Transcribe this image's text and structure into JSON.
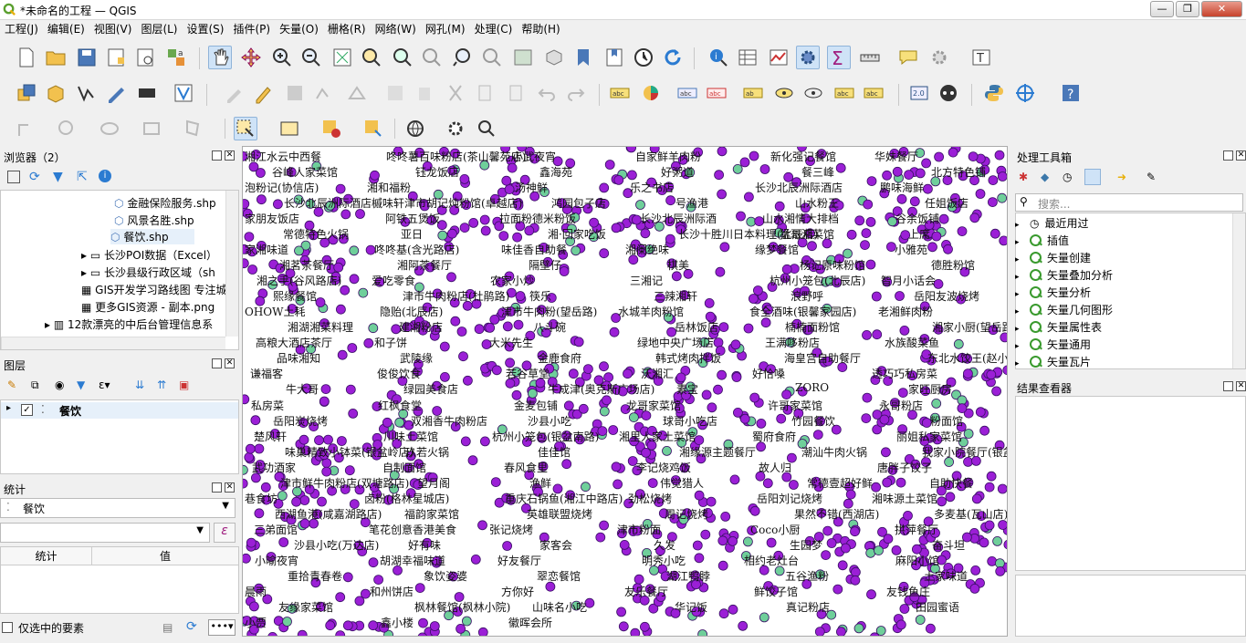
{
  "window": {
    "title": "*未命名的工程 — QGIS",
    "minimize": "—",
    "restore": "❐",
    "close": "✕"
  },
  "menu": [
    "工程(J)",
    "编辑(E)",
    "视图(V)",
    "图层(L)",
    "设置(S)",
    "插件(P)",
    "矢量(O)",
    "栅格(R)",
    "网络(W)",
    "网孔(M)",
    "处理(C)",
    "帮助(H)"
  ],
  "browser": {
    "title": "浏览器（2）",
    "items": [
      "金融保险服务.shp",
      "风景名胜.shp",
      "餐饮.shp",
      "长沙POI数据（Excel）",
      "长沙县级行政区域（sh",
      "GIS开发学习路线图 专注城",
      "更多GIS资源 - 副本.png",
      "12款漂亮的中后台管理信息系"
    ]
  },
  "layers": {
    "title": "图层",
    "items": [
      {
        "name": "餐饮",
        "checked": true
      }
    ]
  },
  "stats": {
    "title": "统计",
    "layer": "餐饮",
    "expr_placeholder": "",
    "col_stat": "统计",
    "col_value": "值",
    "selected_only": "仅选中的要素"
  },
  "toolbox": {
    "title": "处理工具箱",
    "search_placeholder": "搜索...",
    "items": [
      "最近用过",
      "插值",
      "矢量创建",
      "矢量叠加分析",
      "矢量分析",
      "矢量几何图形",
      "矢量属性表",
      "矢量通用",
      "矢量瓦片"
    ]
  },
  "results": {
    "title": "结果查看器"
  },
  "colors": {
    "point_fill": "#9b1fd6",
    "point_stroke": "#3a1066",
    "point_alt": "#6fcf9a",
    "accent": "#3a9a2e"
  },
  "map_labels": [
    "湘江水云中西餐",
    "咚咚薯百味粉店(茶山馨苑店)",
    "小武夜宵",
    "自家鲜羊肉粉",
    "新化强记餐馆",
    "华妹餐厅",
    "谷峰人家菜馆",
    "钰龙饭店",
    "鑫海苑",
    "好粥道",
    "餐三峰",
    "北方特色铺",
    "泡粉记(协信店)",
    "湘和福粉",
    "汤神鲜",
    "乐之书店",
    "长沙北辰洲际酒店",
    "鹏味海鲜",
    "长沙北辰洲际酒店槭味轩",
    "津市胡记炖粉馆(卓越店)",
    "鸿园包子店",
    "号渔港",
    "山水粉王",
    "任姐饭店",
    "家朋友饭店",
    "阿铁五煲饭",
    "拉面粉德米粉饭",
    "长沙北辰洲际酒",
    "山水湘情大排档",
    "谷余饭铺",
    "常德特色火锅",
    "亚日",
    "湘·回家吃饭",
    "长沙十胜川日本料理(北辰店)",
    "猛哥湘菜馆",
    "上席",
    "家湘味道",
    "咚咚基(含光路店)",
    "味佳香自助餐",
    "湘阑绝味",
    "缘梦餐馆",
    "小雅苑",
    "湘茗茶餐厅",
    "湘阿茶餐厅",
    "隔壁仔",
    "棋美",
    "杨记原味粉馆",
    "德胜粉馆",
    "湘之手(谷风路店)",
    "爱吃零食",
    "农家小炒",
    "三湘记",
    "杭州小笼包(北辰店)",
    "智月小话会",
    "熙缘餐馆",
    "津市牛肉粉店(杜鹃路)",
    "筷乐",
    "三辣湘轩",
    "浪野呼",
    "岳阳友波烧烤",
    "OHOW土耗",
    "隐贻(北辰店)",
    "津市牛肉粉(望岳路)",
    "水城羊肉粉馆",
    "食全酒味(银馨家园店)",
    "老湘鲜肉粉",
    "湘湖湘菜料理",
    "建湘粉店",
    "八斗碗",
    "岳林饭店",
    "楠楠面粉馆",
    "湘家小厨(望岳路)",
    "高粮大酒店茶厅",
    "和子饼",
    "大米先生",
    "绿地中央广场店",
    "王满哆粉店",
    "水族酸菜鱼",
    "品味湘知",
    "武陵缘",
    "金鹿食府",
    "韩式烤肉拌饭",
    "海皇宫自助餐厅",
    "东北水饺王(赵小姐河西第三分店)",
    "谦福客",
    "俊俊饮食",
    "若谷草堂",
    "沃湘汇",
    "好恰嗓",
    "透巧巧私房菜",
    "牛大哥",
    "绿园美食店",
    "牛成津(奥克斯广场店)",
    "素宝",
    "ZORO",
    "家旺厨房",
    "私房菜",
    "红枫食堂",
    "金麦包铺",
    "龙哥家菜馆",
    "许哥家菜馆",
    "永哥粉店",
    "岳阳炭烧烤",
    "双湘香牛肉粉店",
    "沙县小吃",
    "球哥小吃店",
    "竹园餐饮",
    "粉面馆",
    "楚风轩",
    "川味土菜馆",
    "杭州小笼包(银盆南路)",
    "湘里人家土菜馆",
    "蜀府食府",
    "丽姐私家菜馆",
    "味巢精致小钵菜(银盆岭店)",
    "玖若火锅",
    "佳佳馆",
    "湘缘源主题餐厅",
    "潮汕牛肉火锅",
    "我家小院餐厅(银盆南路)",
    "武功酒家",
    "自制面馆",
    "春风食里",
    "李记烧鸡饭",
    "故人归",
    "唐胖子饺子",
    "津市鲜牛肉粉店(双塘路店)",
    "望月阁",
    "渔鲜",
    "伟觉猎人",
    "常德壹超好鲜",
    "自助快餐",
    "巷食坊",
    "卤粉(格林星城店)",
    "重庆石锅鱼(湘江中路店)",
    "劲松烧烤",
    "岳阳刘记烧烤",
    "湘味源土菜馆",
    "西湖鱼港(咸嘉湖路店)",
    "福韵家菜馆",
    "英雄联盟烧烤",
    "周记烧烤",
    "果然不错(西湖店)",
    "多麦基(瓦山店)",
    "三弟面馆",
    "笔花创意香港美食",
    "张记烧烤",
    "津市粉面",
    "Coco小厨",
    "拱萍餐厅",
    "沙县小吃(万达店)",
    "好有味",
    "家客会",
    "久发",
    "生园梦",
    "奋斗坦",
    "小喻夜宵",
    "胡湖幸福味道",
    "好友餐厅",
    "明秀小吃",
    "相约老灶台",
    "麻阳小馆",
    "重拾青春卷",
    "象饮姿婆",
    "翠恋餐馆",
    "湖江鸭脖",
    "五谷渔粉",
    "土家味道",
    "晨雨",
    "和州饼店",
    "方你好",
    "友乐餐厅",
    "鲜饺子馆",
    "友钱鱼庄",
    "友缘家菜馆",
    "枫林餐馆(枫林小院)",
    "山味名小吃",
    "华记饭",
    "真记粉店",
    "田园蜜语",
    "小贾",
    "鑫小楼",
    "徽晖会所"
  ]
}
